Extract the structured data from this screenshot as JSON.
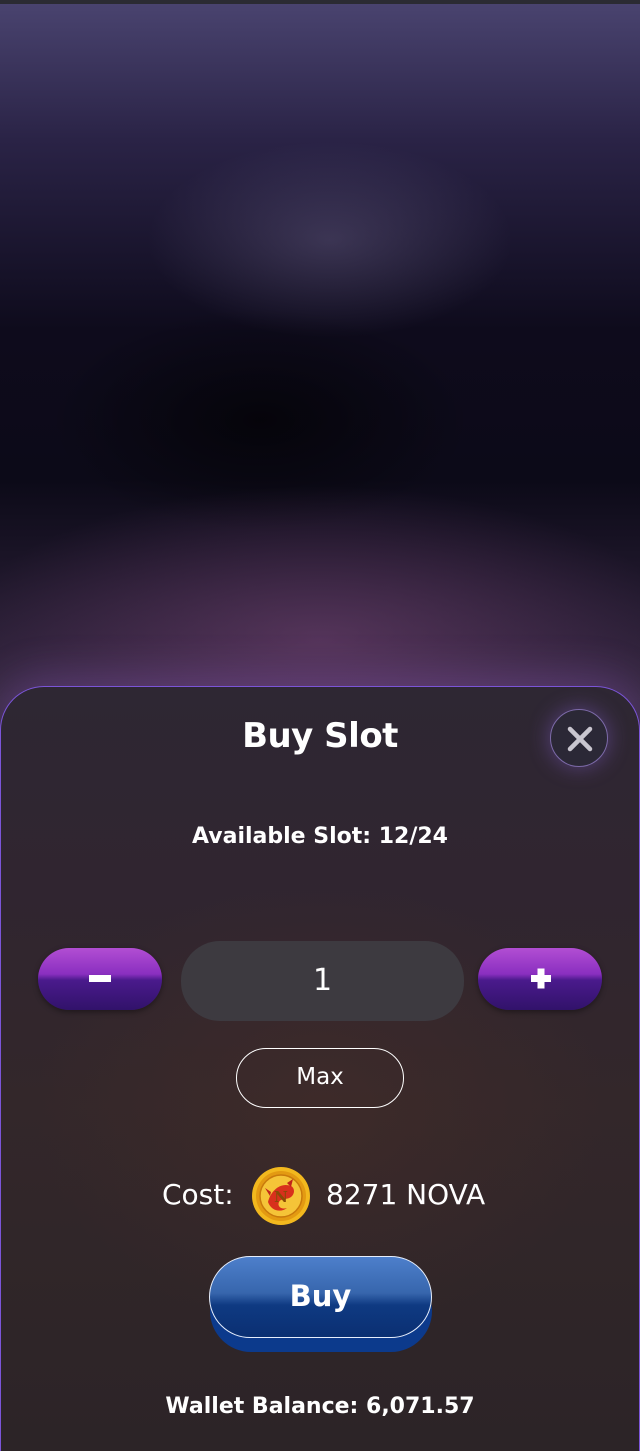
{
  "modal": {
    "title": "Buy Slot",
    "available_slot": "Available Slot: 12/24",
    "quantity": "1",
    "max_label": "Max",
    "cost_label": "Cost:",
    "cost_amount": "8271 NOVA",
    "buy_label": "Buy",
    "wallet_balance": "Wallet Balance: 6,071.57"
  },
  "icons": {
    "close": "close-icon",
    "minus": "minus-icon",
    "plus": "plus-icon",
    "coin": "nova-coin-icon"
  },
  "colors": {
    "accent_purple": "#8a2fc0",
    "buy_blue": "#0f3a82",
    "sheet_border": "#7b55d8",
    "coin_gold": "#f2b81e"
  }
}
